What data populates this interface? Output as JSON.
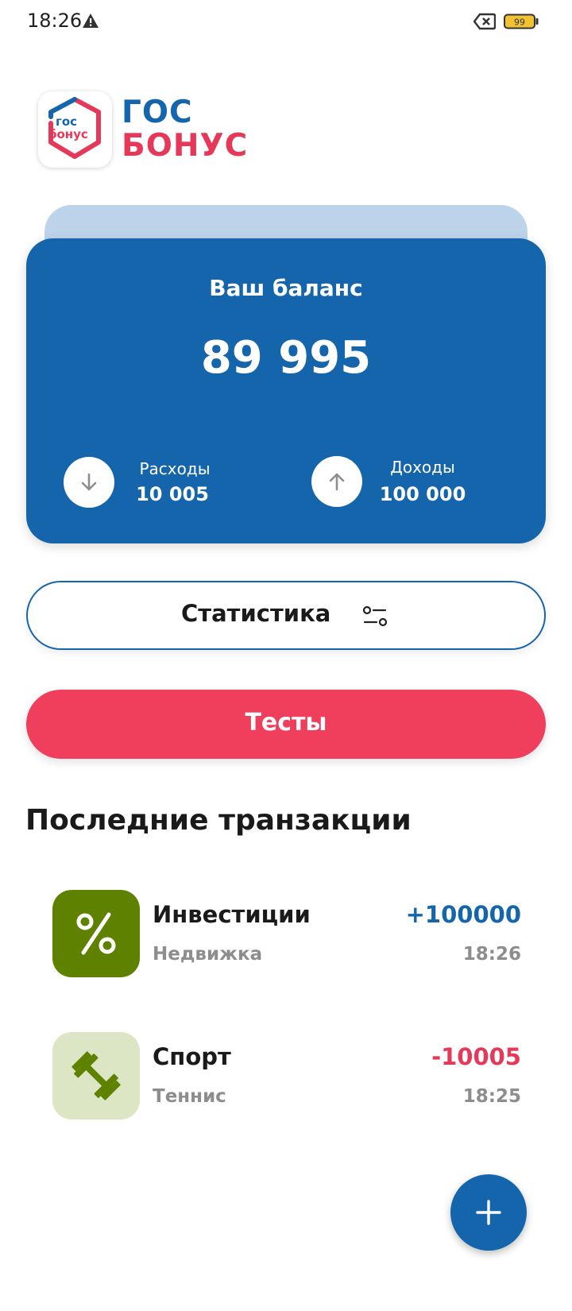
{
  "status_bar": {
    "time": "18:26",
    "battery_level": "99",
    "icons": [
      "warning-icon",
      "no-sim-icon",
      "battery-icon"
    ]
  },
  "logo": {
    "badge_line1": "гос",
    "badge_line2": "бонус",
    "word1": "ГОС",
    "word2": "БОНУС",
    "colors": {
      "blue": "#1565ad",
      "red": "#e6395a"
    }
  },
  "balance_card": {
    "title": "Ваш баланс",
    "amount": "89 995",
    "expenses": {
      "label": "Расходы",
      "value": "10 005",
      "icon": "arrow-down-icon"
    },
    "income": {
      "label": "Доходы",
      "value": "100 000",
      "icon": "arrow-up-icon"
    },
    "colors": {
      "card": "#1565ad",
      "card_back": "#bdd3e9"
    }
  },
  "buttons": {
    "statistics": {
      "label": "Статистика",
      "icon": "filter-sliders-icon"
    },
    "tests": {
      "label": "Тесты",
      "color": "#ef3f5c"
    }
  },
  "transactions": {
    "title": "Последние транзакции",
    "items": [
      {
        "title": "Инвестиции",
        "subtitle": "Недвижка",
        "amount": "+100000",
        "time": "18:26",
        "icon": "percent-icon",
        "icon_bg": "#5e8200"
      },
      {
        "title": "Спорт",
        "subtitle": "Теннис",
        "amount": "-10005",
        "time": "18:25",
        "icon": "dumbbell-icon",
        "icon_bg": "#dde6c4"
      }
    ]
  },
  "fab": {
    "icon": "plus-icon"
  }
}
